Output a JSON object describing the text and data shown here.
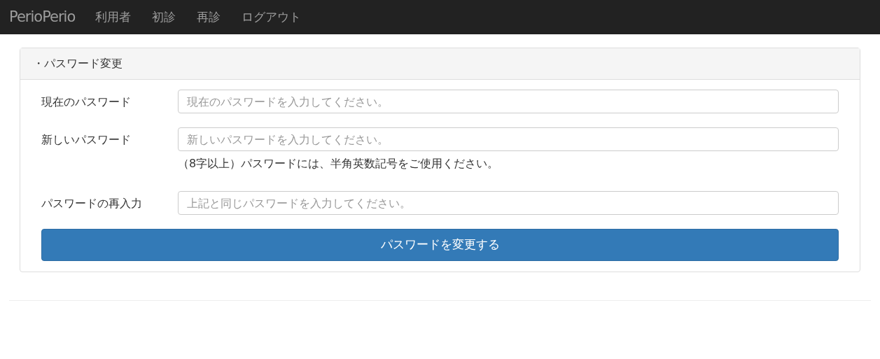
{
  "navbar": {
    "brand": "PerioPerio",
    "links": [
      "利用者",
      "初診",
      "再診",
      "ログアウト"
    ]
  },
  "panel": {
    "heading": "・パスワード変更",
    "fields": [
      {
        "label": "現在のパスワード",
        "placeholder": "現在のパスワードを入力してください。"
      },
      {
        "label": "新しいパスワード",
        "placeholder": "新しいパスワードを入力してください。",
        "help": "（8字以上）パスワードには、半角英数記号をご使用ください。"
      },
      {
        "label": "パスワードの再入力",
        "placeholder": "上記と同じパスワードを入力してください。"
      }
    ],
    "submit": "パスワードを変更する"
  }
}
